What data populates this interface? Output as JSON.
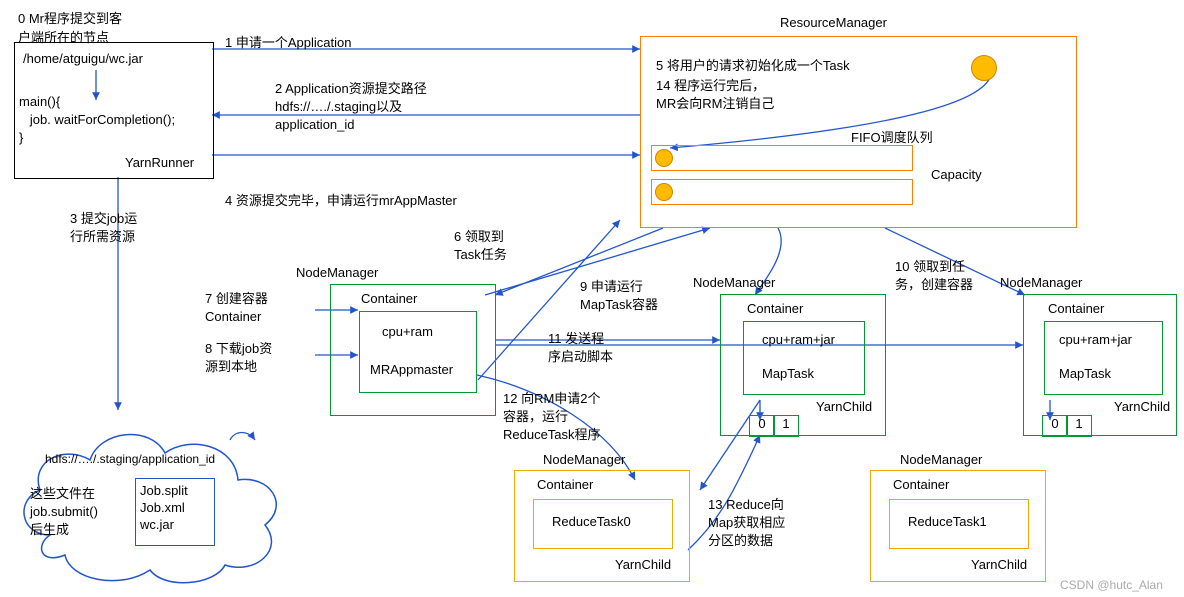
{
  "client": {
    "title": "0 Mr程序提交到客\n户端所在的节点",
    "path": "/home/atguigu/wc.jar",
    "code": "main(){\n   job. waitForCompletion();\n}",
    "runner": "YarnRunner"
  },
  "rm": {
    "title": "ResourceManager",
    "task_init": "5 将用户的请求初始化成一个Task",
    "finish": "14 程序运行完后，\nMR会向RM注销自己",
    "queue_label": "FIFO调度队列",
    "capacity": "Capacity"
  },
  "steps": {
    "s1": "1 申请一个Application",
    "s2": "2 Application资源提交路径\nhdfs://…./.staging以及\napplication_id",
    "s3": "3 提交job运\n行所需资源",
    "s4": "4 资源提交完毕，申请运行mrAppMaster",
    "s6": "6 领取到\nTask任务",
    "s7": "7 创建容器\nContainer",
    "s8": "8 下载job资\n源到本地",
    "s9": "9 申请运行\nMapTask容器",
    "s10": "10 领取到任\n务，创建容器",
    "s11": "11 发送程\n序启动脚本",
    "s12": "12 向RM申请2个\n容器，运行\nReduceTask程序",
    "s13": "13 Reduce向\nMap获取相应\n分区的数据"
  },
  "nm1": {
    "title": "NodeManager",
    "container": "Container",
    "body": "cpu+ram",
    "task": "MRAppmaster"
  },
  "nm2": {
    "title": "NodeManager",
    "container": "Container",
    "body": "cpu+ram+jar",
    "task": "MapTask",
    "child": "YarnChild",
    "p0": "0",
    "p1": "1"
  },
  "nm3": {
    "title": "NodeManager",
    "container": "Container",
    "body": "cpu+ram+jar",
    "task": "MapTask",
    "child": "YarnChild",
    "p0": "0",
    "p1": "1"
  },
  "nm4": {
    "title": "NodeManager",
    "container": "Container",
    "task": "ReduceTask0",
    "child": "YarnChild"
  },
  "nm5": {
    "title": "NodeManager",
    "container": "Container",
    "task": "ReduceTask1",
    "child": "YarnChild"
  },
  "hdfs": {
    "path": "hdfs://…./.staging/application_id",
    "note": "这些文件在\njob.submit()\n后生成",
    "files": "Job.split\nJob.xml\nwc.jar"
  },
  "watermark": "CSDN @hutc_Alan"
}
